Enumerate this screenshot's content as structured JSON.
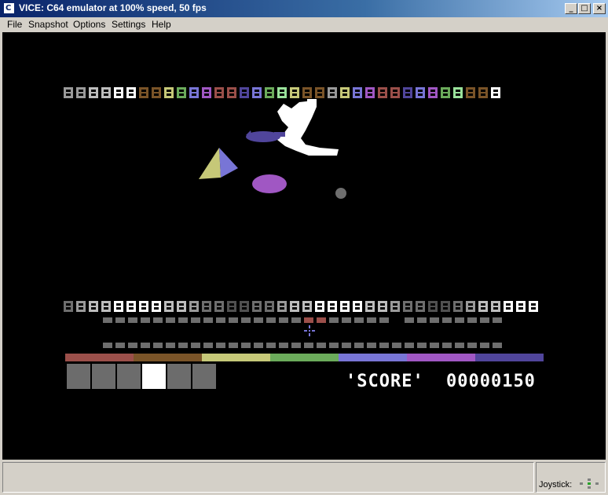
{
  "window": {
    "title": "VICE: C64 emulator at 100% speed, 50 fps",
    "app_icon": "C"
  },
  "window_buttons": {
    "minimize": "_",
    "maximize": "□",
    "close": "×"
  },
  "menu": [
    {
      "label": "File"
    },
    {
      "label": "Snapshot"
    },
    {
      "label": "Options"
    },
    {
      "label": "Settings"
    },
    {
      "label": "Help"
    }
  ],
  "game": {
    "score_label": "'SCORE'",
    "score_value": "00000150",
    "top_row_colors": [
      "#9a9a9a",
      "#9a9a9a",
      "#bdbdbd",
      "#bdbdbd",
      "#ffffff",
      "#ffffff",
      "#7a5428",
      "#7a5428",
      "#c6c878",
      "#6bab5b",
      "#7875d6",
      "#a057c3",
      "#9b4f4a",
      "#9b4f4a",
      "#50459b",
      "#7875d6",
      "#6bab5b",
      "#9ae29b",
      "#c6c878",
      "#7a5428",
      "#7a5428",
      "#9a9a9a",
      "#c6c878",
      "#7875d6",
      "#a057c3",
      "#9b4f4a",
      "#9b4f4a",
      "#50459b",
      "#7875d6",
      "#a057c3",
      "#6bab5b",
      "#9ae29b",
      "#7a5428",
      "#7a5428",
      "#ffffff"
    ],
    "bottom_row_colors": [
      "#6e6e6e",
      "#9a9a9a",
      "#bdbdbd",
      "#bdbdbd",
      "#ffffff",
      "#ffffff",
      "#ffffff",
      "#ffffff",
      "#bdbdbd",
      "#bdbdbd",
      "#9a9a9a",
      "#6e6e6e",
      "#6e6e6e",
      "#505050",
      "#505050",
      "#6e6e6e",
      "#6e6e6e",
      "#9a9a9a",
      "#bdbdbd",
      "#bdbdbd",
      "#ffffff",
      "#ffffff",
      "#ffffff",
      "#ffffff",
      "#bdbdbd",
      "#bdbdbd",
      "#9a9a9a",
      "#6e6e6e",
      "#6e6e6e",
      "#505050",
      "#505050",
      "#6e6e6e",
      "#9a9a9a",
      "#bdbdbd",
      "#bdbdbd",
      "#ffffff",
      "#ffffff",
      "#ffffff"
    ],
    "rainbow_colors": [
      "#9b4f4a",
      "#7a5428",
      "#c6c878",
      "#6bab5b",
      "#7875d6",
      "#a057c3",
      "#50459b"
    ],
    "icon_names": [
      "stars-icon",
      "warrior-icon",
      "mountains-icon",
      "dragon-icon",
      "grid-icon",
      "trident-icon"
    ],
    "selected_icon": 3
  },
  "status": {
    "joystick_label": "Joystick:"
  }
}
